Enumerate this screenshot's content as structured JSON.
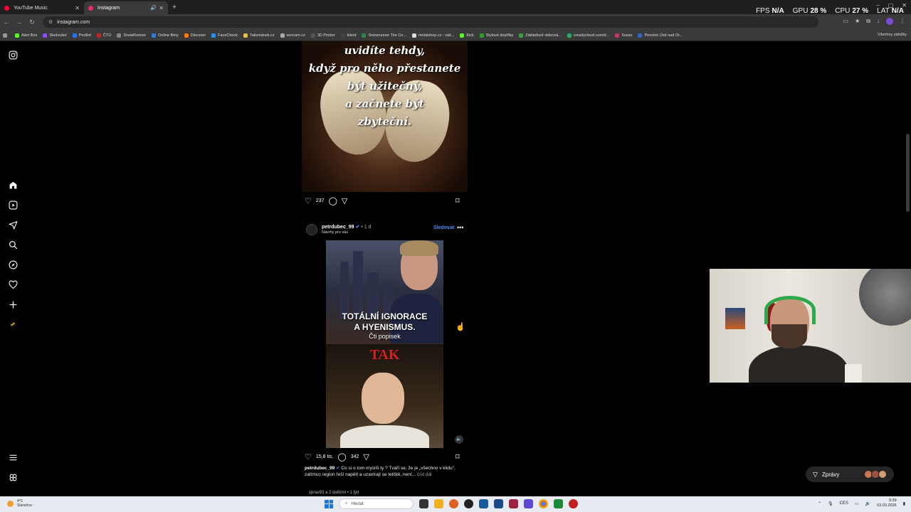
{
  "browser": {
    "tabs": [
      {
        "label": "YouTube Music",
        "color": "#ff0033"
      },
      {
        "label": "Instagram",
        "color": "#e1306c"
      }
    ],
    "url": "instagram.com",
    "bookmarks": [
      {
        "label": "Alert Box",
        "color": "#53fc18"
      },
      {
        "label": "Sledování",
        "color": "#9146ff"
      },
      {
        "label": "Prošlot",
        "color": "#1f74ff"
      },
      {
        "label": "ČTÚ",
        "color": "#cc2222"
      },
      {
        "label": "SnowRunner",
        "color": "#888888"
      },
      {
        "label": "Online filmy",
        "color": "#2a7ae2"
      },
      {
        "label": "Discover",
        "color": "#ff7a00"
      },
      {
        "label": "FaceCheck",
        "color": "#1e90ff"
      },
      {
        "label": "Talismánek.cz",
        "color": "#e0c040"
      },
      {
        "label": "worcam.cz",
        "color": "#aaaaaa"
      },
      {
        "label": "3D Printer",
        "color": "#555555"
      },
      {
        "label": "klient",
        "color": "#444444"
      },
      {
        "label": "Snowrunner Tire Co...",
        "color": "#2a8a4a"
      },
      {
        "label": "metalshop.cz - váš...",
        "color": "#dddddd"
      },
      {
        "label": "Kick",
        "color": "#53fc18"
      },
      {
        "label": "Stylové doplňky",
        "color": "#2aa02a"
      },
      {
        "label": "Základové videozá...",
        "color": "#3aa03a"
      },
      {
        "label": "creaitycloud.com/d...",
        "color": "#22aa66"
      },
      {
        "label": "Susso",
        "color": "#cc3366"
      },
      {
        "label": "Penzion Ústí nad Or...",
        "color": "#3366cc"
      }
    ],
    "bookmarks_all": "Všechny záložky"
  },
  "overlay": {
    "fps_label": "FPS",
    "fps_value": "N/A",
    "gpu_label": "GPU",
    "gpu_value": "28 %",
    "cpu_label": "CPU",
    "cpu_value": "27 %",
    "lat_label": "LAT",
    "lat_value": "N/A"
  },
  "post1": {
    "image_text": [
      "uvidíte tehdy,",
      "když pro něho přestanete",
      "být užitečný,",
      "a začnete být",
      "zbyteční."
    ],
    "likes": "237"
  },
  "post2": {
    "username": "petrdubec_99",
    "time": "• 1 d",
    "subtitle": "Návrhy pro vás",
    "follow_label": "Sledovat",
    "video_text_1": "TOTÁLNÍ IGNORACE",
    "video_text_2": "A HYENISMUS.",
    "video_text_3": "Čti popisek",
    "video_text_4": "TAK",
    "likes": "15,8 tis.",
    "comments": "342",
    "caption_user": "petrdubec_99",
    "caption_text": "Co si o tom myslíš ty ? Tváří se, že je „všechno v klidu\", zatímco region řeší napětí a uzavírají se letiště, není...",
    "caption_more": "číst dál"
  },
  "next_post_user": "vprav93 a 2 dalšími • 1 týd",
  "messages_label": "Zprávy",
  "taskbar": {
    "weather_temp": "4°C",
    "weather_desc": "Slunečno",
    "search_placeholder": "Hledat",
    "lang": "CES",
    "time": "9:39",
    "date": "03.03.2026"
  }
}
